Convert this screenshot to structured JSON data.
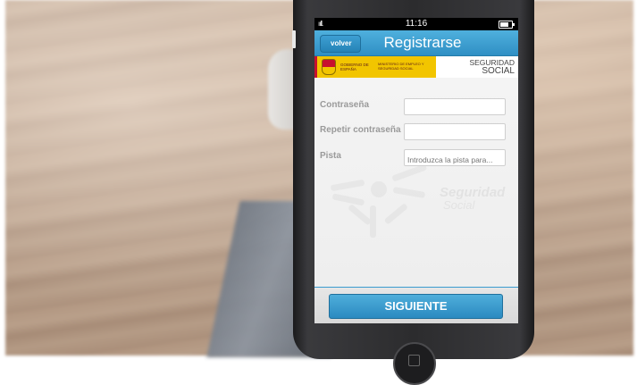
{
  "status_bar": {
    "time": "11:16",
    "signal": "ııll."
  },
  "nav": {
    "back_label": "volver",
    "title": "Registrarse"
  },
  "banner": {
    "gobierno": "GOBIERNO DE ESPAÑA",
    "ministerio": "MINISTERIO DE EMPLEO Y SEGURIDAD SOCIAL",
    "seguridad_line1": "SEGURIDAD",
    "seguridad_line2": "SOCIAL"
  },
  "form": {
    "fields": [
      {
        "label": "Contraseña",
        "value": "",
        "placeholder": ""
      },
      {
        "label": "Repetir contraseña",
        "value": "",
        "placeholder": ""
      },
      {
        "label": "Pista",
        "value": "",
        "placeholder": "Introduzca la pista para..."
      }
    ]
  },
  "watermark_text": {
    "line1": "Seguridad",
    "line2": "Social"
  },
  "footer": {
    "next_label": "SIGUIENTE"
  },
  "colors": {
    "accent": "#2f8fc4",
    "banner_yellow": "#f2c500"
  }
}
